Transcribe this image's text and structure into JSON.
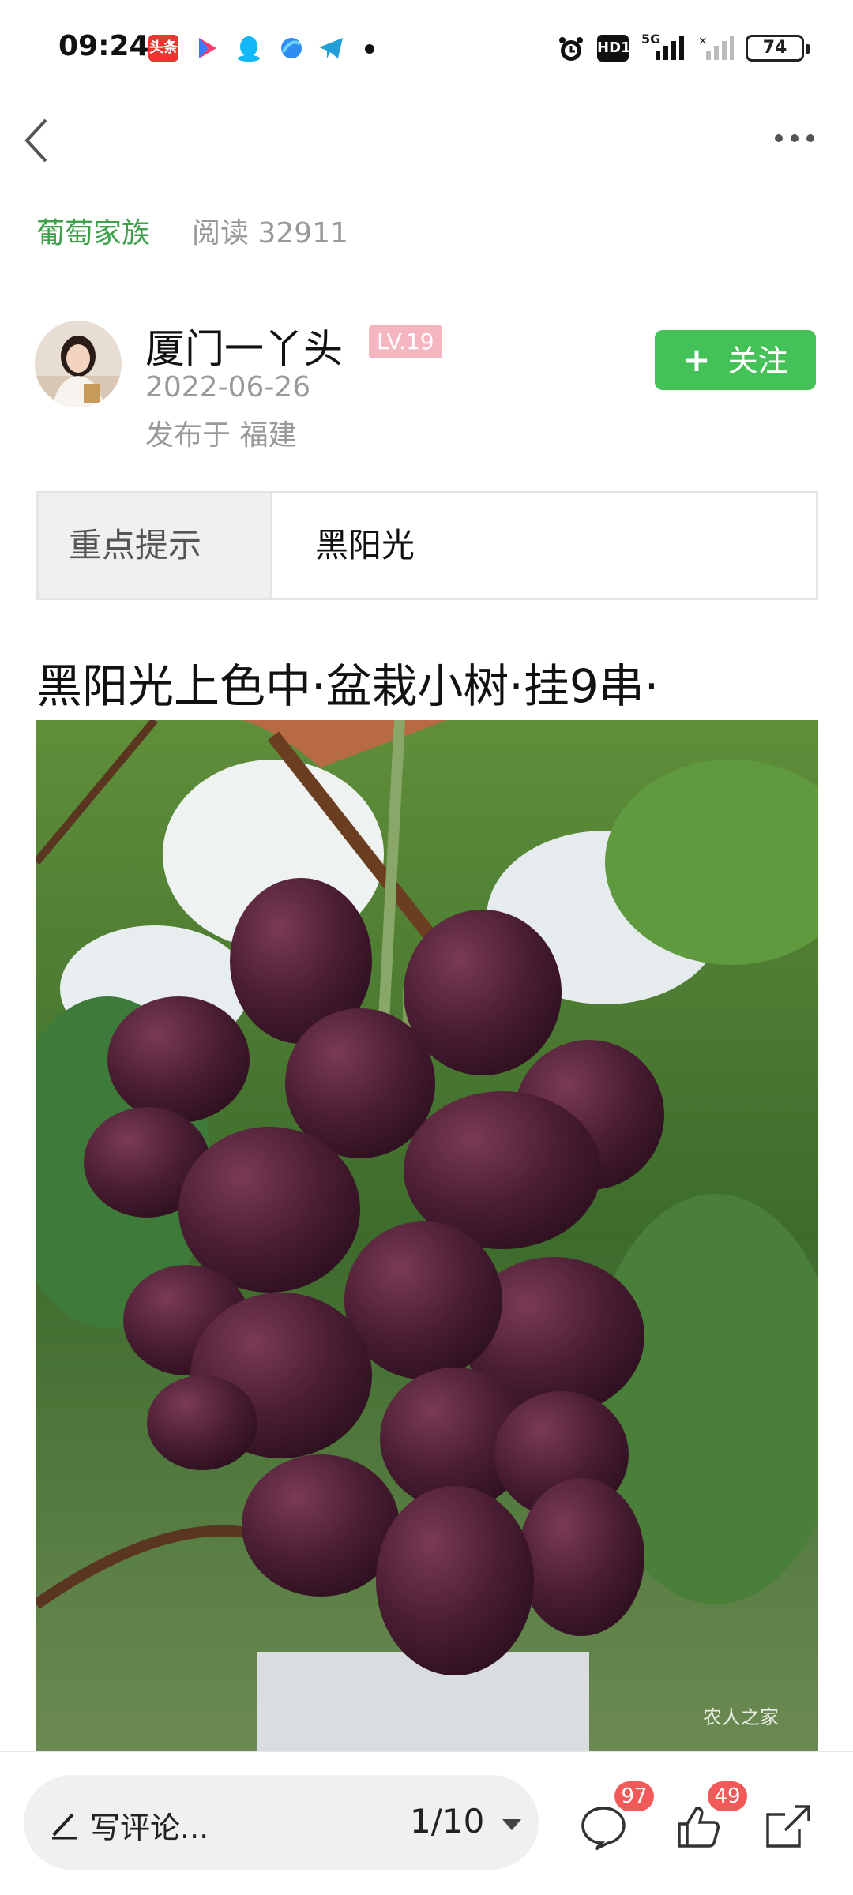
{
  "status_bar": {
    "time": "09:24",
    "battery": "74",
    "network": "5G",
    "hd": "HD1",
    "icons": [
      "toutiao-icon",
      "app-icon",
      "qq-icon",
      "browser-icon",
      "telegram-icon",
      "dot-icon",
      "alarm-icon",
      "hd-icon",
      "signal-icon",
      "no-signal-icon",
      "battery-icon"
    ]
  },
  "header": {
    "community": "葡萄家族",
    "reads": "阅读 32911"
  },
  "author": {
    "name": "厦门一丫头",
    "level": "LV.19",
    "date": "2022-06-26",
    "location": "发布于 福建",
    "follow_label": "关注"
  },
  "tip": {
    "label": "重点提示",
    "value": "黑阳光"
  },
  "post": {
    "title": "黑阳光上色中·盆栽小树·挂9串·",
    "watermark": "农人之家"
  },
  "bottom_bar": {
    "comment_placeholder": "写评论...",
    "page_indicator": "1/10",
    "comment_count": "97",
    "like_count": "49"
  },
  "colors": {
    "accent_green": "#44c258",
    "community_green": "#3ea04a",
    "level_pink": "#f6b6c1",
    "badge_red": "#f25a5a"
  }
}
